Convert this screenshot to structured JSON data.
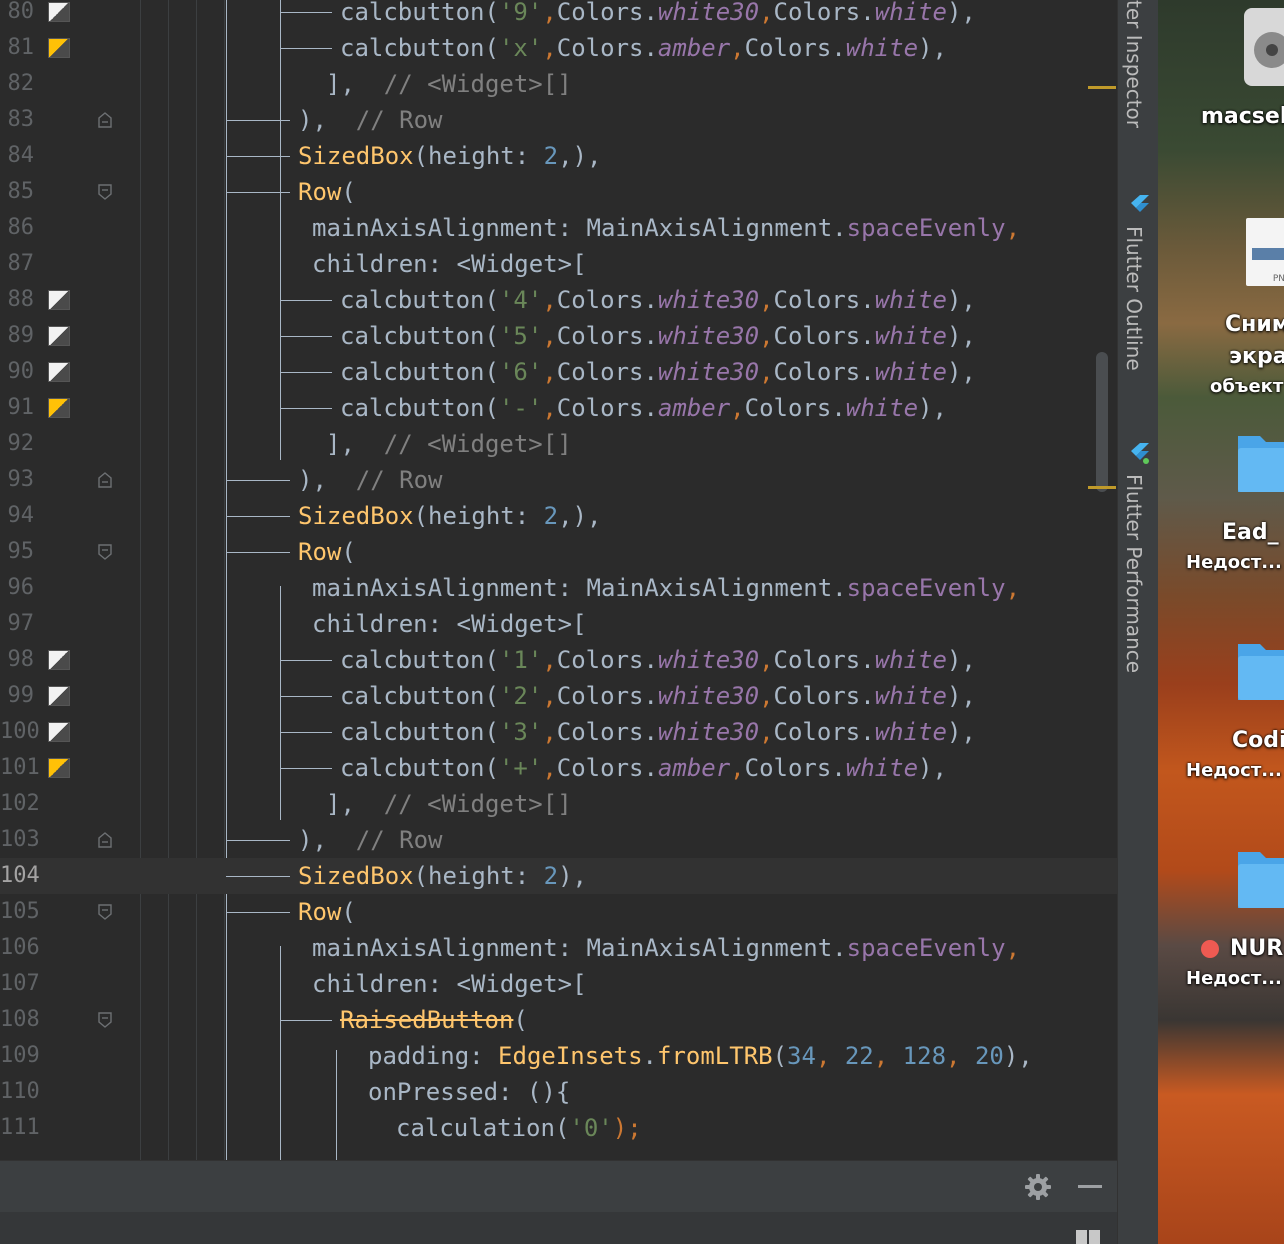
{
  "editor": {
    "current_line": "104",
    "lines": [
      {
        "n": "80",
        "i": 2,
        "swatch": "white",
        "segs": [
          [
            "calcbutton",
            "d"
          ],
          [
            "(",
            "d"
          ],
          [
            "'9'",
            "s"
          ],
          [
            ",",
            "p"
          ],
          [
            "Colors.",
            "d"
          ],
          [
            "white30",
            "it"
          ],
          [
            ",",
            "p"
          ],
          [
            "Colors.",
            "d"
          ],
          [
            "white",
            "it"
          ],
          [
            "),",
            "d"
          ]
        ]
      },
      {
        "n": "81",
        "i": 2,
        "swatch": "amber",
        "segs": [
          [
            "calcbutton",
            "d"
          ],
          [
            "(",
            "d"
          ],
          [
            "'x'",
            "s"
          ],
          [
            ",",
            "p"
          ],
          [
            "Colors.",
            "d"
          ],
          [
            "amber",
            "it"
          ],
          [
            ",",
            "p"
          ],
          [
            "Colors.",
            "d"
          ],
          [
            "white",
            "it"
          ],
          [
            "),",
            "d"
          ]
        ]
      },
      {
        "n": "82",
        "i": 1.5,
        "segs": [
          [
            "],",
            "d"
          ],
          [
            "  // <Widget>[]",
            "c"
          ]
        ]
      },
      {
        "n": "83",
        "i": 0.5,
        "fold": "end",
        "segs": [
          [
            "),",
            "d"
          ],
          [
            "  // Row",
            "c"
          ]
        ]
      },
      {
        "n": "84",
        "i": 0.5,
        "segs": [
          [
            "SizedBox",
            "k"
          ],
          [
            "(height: ",
            "d"
          ],
          [
            "2",
            "n"
          ],
          [
            ",),",
            "d"
          ]
        ]
      },
      {
        "n": "85",
        "i": 0.5,
        "fold": "start",
        "segs": [
          [
            "Row",
            "k"
          ],
          [
            "(",
            "d"
          ]
        ]
      },
      {
        "n": "86",
        "i": 1,
        "segs": [
          [
            "mainAxisAlignment: MainAxisAlignment.",
            "d"
          ],
          [
            "spaceEvenly",
            "pr"
          ],
          [
            ",",
            "p"
          ]
        ]
      },
      {
        "n": "87",
        "i": 1,
        "segs": [
          [
            "children: <Widget>[",
            "d"
          ]
        ]
      },
      {
        "n": "88",
        "i": 2,
        "swatch": "white",
        "segs": [
          [
            "calcbutton",
            "d"
          ],
          [
            "(",
            "d"
          ],
          [
            "'4'",
            "s"
          ],
          [
            ",",
            "p"
          ],
          [
            "Colors.",
            "d"
          ],
          [
            "white30",
            "it"
          ],
          [
            ",",
            "p"
          ],
          [
            "Colors.",
            "d"
          ],
          [
            "white",
            "it"
          ],
          [
            "),",
            "d"
          ]
        ]
      },
      {
        "n": "89",
        "i": 2,
        "swatch": "white",
        "segs": [
          [
            "calcbutton",
            "d"
          ],
          [
            "(",
            "d"
          ],
          [
            "'5'",
            "s"
          ],
          [
            ",",
            "p"
          ],
          [
            "Colors.",
            "d"
          ],
          [
            "white30",
            "it"
          ],
          [
            ",",
            "p"
          ],
          [
            "Colors.",
            "d"
          ],
          [
            "white",
            "it"
          ],
          [
            "),",
            "d"
          ]
        ]
      },
      {
        "n": "90",
        "i": 2,
        "swatch": "white",
        "segs": [
          [
            "calcbutton",
            "d"
          ],
          [
            "(",
            "d"
          ],
          [
            "'6'",
            "s"
          ],
          [
            ",",
            "p"
          ],
          [
            "Colors.",
            "d"
          ],
          [
            "white30",
            "it"
          ],
          [
            ",",
            "p"
          ],
          [
            "Colors.",
            "d"
          ],
          [
            "white",
            "it"
          ],
          [
            "),",
            "d"
          ]
        ]
      },
      {
        "n": "91",
        "i": 2,
        "swatch": "amber",
        "segs": [
          [
            "calcbutton",
            "d"
          ],
          [
            "(",
            "d"
          ],
          [
            "'-'",
            "s"
          ],
          [
            ",",
            "p"
          ],
          [
            "Colors.",
            "d"
          ],
          [
            "amber",
            "it"
          ],
          [
            ",",
            "p"
          ],
          [
            "Colors.",
            "d"
          ],
          [
            "white",
            "it"
          ],
          [
            "),",
            "d"
          ]
        ]
      },
      {
        "n": "92",
        "i": 1.5,
        "segs": [
          [
            "],",
            "d"
          ],
          [
            "  // <Widget>[]",
            "c"
          ]
        ]
      },
      {
        "n": "93",
        "i": 0.5,
        "fold": "end",
        "segs": [
          [
            "),",
            "d"
          ],
          [
            "  // Row",
            "c"
          ]
        ]
      },
      {
        "n": "94",
        "i": 0.5,
        "segs": [
          [
            "SizedBox",
            "k"
          ],
          [
            "(height: ",
            "d"
          ],
          [
            "2",
            "n"
          ],
          [
            ",),",
            "d"
          ]
        ]
      },
      {
        "n": "95",
        "i": 0.5,
        "fold": "start",
        "segs": [
          [
            "Row",
            "k"
          ],
          [
            "(",
            "d"
          ]
        ]
      },
      {
        "n": "96",
        "i": 1,
        "segs": [
          [
            "mainAxisAlignment: MainAxisAlignment.",
            "d"
          ],
          [
            "spaceEvenly",
            "pr"
          ],
          [
            ",",
            "p"
          ]
        ]
      },
      {
        "n": "97",
        "i": 1,
        "segs": [
          [
            "children: <Widget>[",
            "d"
          ]
        ]
      },
      {
        "n": "98",
        "i": 2,
        "swatch": "white",
        "segs": [
          [
            "calcbutton",
            "d"
          ],
          [
            "(",
            "d"
          ],
          [
            "'1'",
            "s"
          ],
          [
            ",",
            "p"
          ],
          [
            "Colors.",
            "d"
          ],
          [
            "white30",
            "it"
          ],
          [
            ",",
            "p"
          ],
          [
            "Colors.",
            "d"
          ],
          [
            "white",
            "it"
          ],
          [
            "),",
            "d"
          ]
        ]
      },
      {
        "n": "99",
        "i": 2,
        "swatch": "white",
        "segs": [
          [
            "calcbutton",
            "d"
          ],
          [
            "(",
            "d"
          ],
          [
            "'2'",
            "s"
          ],
          [
            ",",
            "p"
          ],
          [
            "Colors.",
            "d"
          ],
          [
            "white30",
            "it"
          ],
          [
            ",",
            "p"
          ],
          [
            "Colors.",
            "d"
          ],
          [
            "white",
            "it"
          ],
          [
            "),",
            "d"
          ]
        ]
      },
      {
        "n": "100",
        "i": 2,
        "swatch": "white",
        "segs": [
          [
            "calcbutton",
            "d"
          ],
          [
            "(",
            "d"
          ],
          [
            "'3'",
            "s"
          ],
          [
            ",",
            "p"
          ],
          [
            "Colors.",
            "d"
          ],
          [
            "white30",
            "it"
          ],
          [
            ",",
            "p"
          ],
          [
            "Colors.",
            "d"
          ],
          [
            "white",
            "it"
          ],
          [
            "),",
            "d"
          ]
        ]
      },
      {
        "n": "101",
        "i": 2,
        "swatch": "amber",
        "segs": [
          [
            "calcbutton",
            "d"
          ],
          [
            "(",
            "d"
          ],
          [
            "'+'",
            "s"
          ],
          [
            ",",
            "p"
          ],
          [
            "Colors.",
            "d"
          ],
          [
            "amber",
            "it"
          ],
          [
            ",",
            "p"
          ],
          [
            "Colors.",
            "d"
          ],
          [
            "white",
            "it"
          ],
          [
            "),",
            "d"
          ]
        ]
      },
      {
        "n": "102",
        "i": 1.5,
        "segs": [
          [
            "],",
            "d"
          ],
          [
            "  // <Widget>[]",
            "c"
          ]
        ]
      },
      {
        "n": "103",
        "i": 0.5,
        "fold": "end",
        "segs": [
          [
            "),",
            "d"
          ],
          [
            "  // Row",
            "c"
          ]
        ]
      },
      {
        "n": "104",
        "i": 0.5,
        "current": true,
        "segs": [
          [
            "SizedBox",
            "k"
          ],
          [
            "(height: ",
            "d"
          ],
          [
            "2",
            "n"
          ],
          [
            "),",
            "d"
          ]
        ]
      },
      {
        "n": "105",
        "i": 0.5,
        "fold": "start",
        "segs": [
          [
            "Row",
            "k"
          ],
          [
            "(",
            "d"
          ]
        ]
      },
      {
        "n": "106",
        "i": 1,
        "segs": [
          [
            "mainAxisAlignment: MainAxisAlignment.",
            "d"
          ],
          [
            "spaceEvenly",
            "pr"
          ],
          [
            ",",
            "p"
          ]
        ]
      },
      {
        "n": "107",
        "i": 1,
        "segs": [
          [
            "children: <Widget>[",
            "d"
          ]
        ]
      },
      {
        "n": "108",
        "i": 2,
        "fold": "start",
        "segs": [
          [
            "RaisedButton",
            "dep"
          ],
          [
            "(",
            "d"
          ]
        ]
      },
      {
        "n": "109",
        "i": 3,
        "segs": [
          [
            "padding: ",
            "d"
          ],
          [
            "EdgeInsets",
            "k"
          ],
          [
            ".",
            "d"
          ],
          [
            "fromLTRB",
            "k"
          ],
          [
            "(",
            "d"
          ],
          [
            "34",
            "n"
          ],
          [
            ", ",
            "p"
          ],
          [
            "22",
            "n"
          ],
          [
            ", ",
            "p"
          ],
          [
            "128",
            "n"
          ],
          [
            ", ",
            "p"
          ],
          [
            "20",
            "n"
          ],
          [
            "),",
            "d"
          ]
        ]
      },
      {
        "n": "110",
        "i": 3,
        "segs": [
          [
            "onPressed: (){",
            "d"
          ]
        ]
      },
      {
        "n": "111",
        "i": 4,
        "segs": [
          [
            "calculation",
            "d"
          ],
          [
            "(",
            "d"
          ],
          [
            "'0'",
            "s"
          ],
          [
            ");",
            "p"
          ]
        ]
      }
    ]
  },
  "tool_windows": {
    "inspector_label": "ter Inspector",
    "outline_label": "Flutter Outline",
    "performance_label": "Flutter Performance"
  },
  "desktop": {
    "user_label": "macsel",
    "screenshot_label_1": "Сним",
    "screenshot_label_2": "экра",
    "screenshot_label_3": "объект",
    "png_badge": "PNG",
    "folder_1_name": "Ead_",
    "folder_1_status": "Недост...",
    "folder_2_name": "Codi",
    "folder_2_status": "Недост...",
    "folder_3_name": "NUR",
    "folder_3_status": "Недост..."
  },
  "colors": {
    "swatch_white": "#f2f2f2",
    "swatch_amber": "#ffc107",
    "accent_mark": "#c09a2a"
  }
}
